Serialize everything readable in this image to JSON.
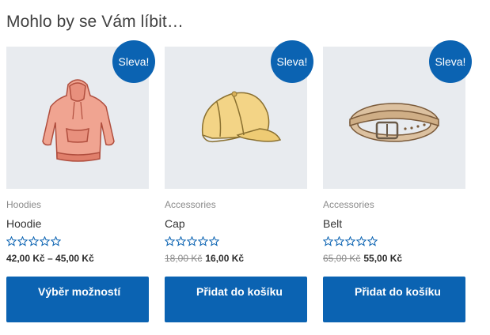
{
  "section": {
    "heading": "Mohlo by se Vám líbit…"
  },
  "colors": {
    "accent": "#0b63b2",
    "thumb_bg": "#e8ebef"
  },
  "products": [
    {
      "sale_badge": "Sleva!",
      "category": "Hoodies",
      "title": "Hoodie",
      "price_old": "",
      "price": "42,00 Kč – 45,00 Kč",
      "button": "Výběr možností",
      "image_icon": "hoodie-icon",
      "rating": 0
    },
    {
      "sale_badge": "Sleva!",
      "category": "Accessories",
      "title": "Cap",
      "price_old": "18,00 Kč",
      "price": "16,00 Kč",
      "button": "Přidat do košíku",
      "image_icon": "cap-icon",
      "rating": 0
    },
    {
      "sale_badge": "Sleva!",
      "category": "Accessories",
      "title": "Belt",
      "price_old": "65,00 Kč",
      "price": "55,00 Kč",
      "button": "Přidat do košíku",
      "image_icon": "belt-icon",
      "rating": 0
    }
  ]
}
